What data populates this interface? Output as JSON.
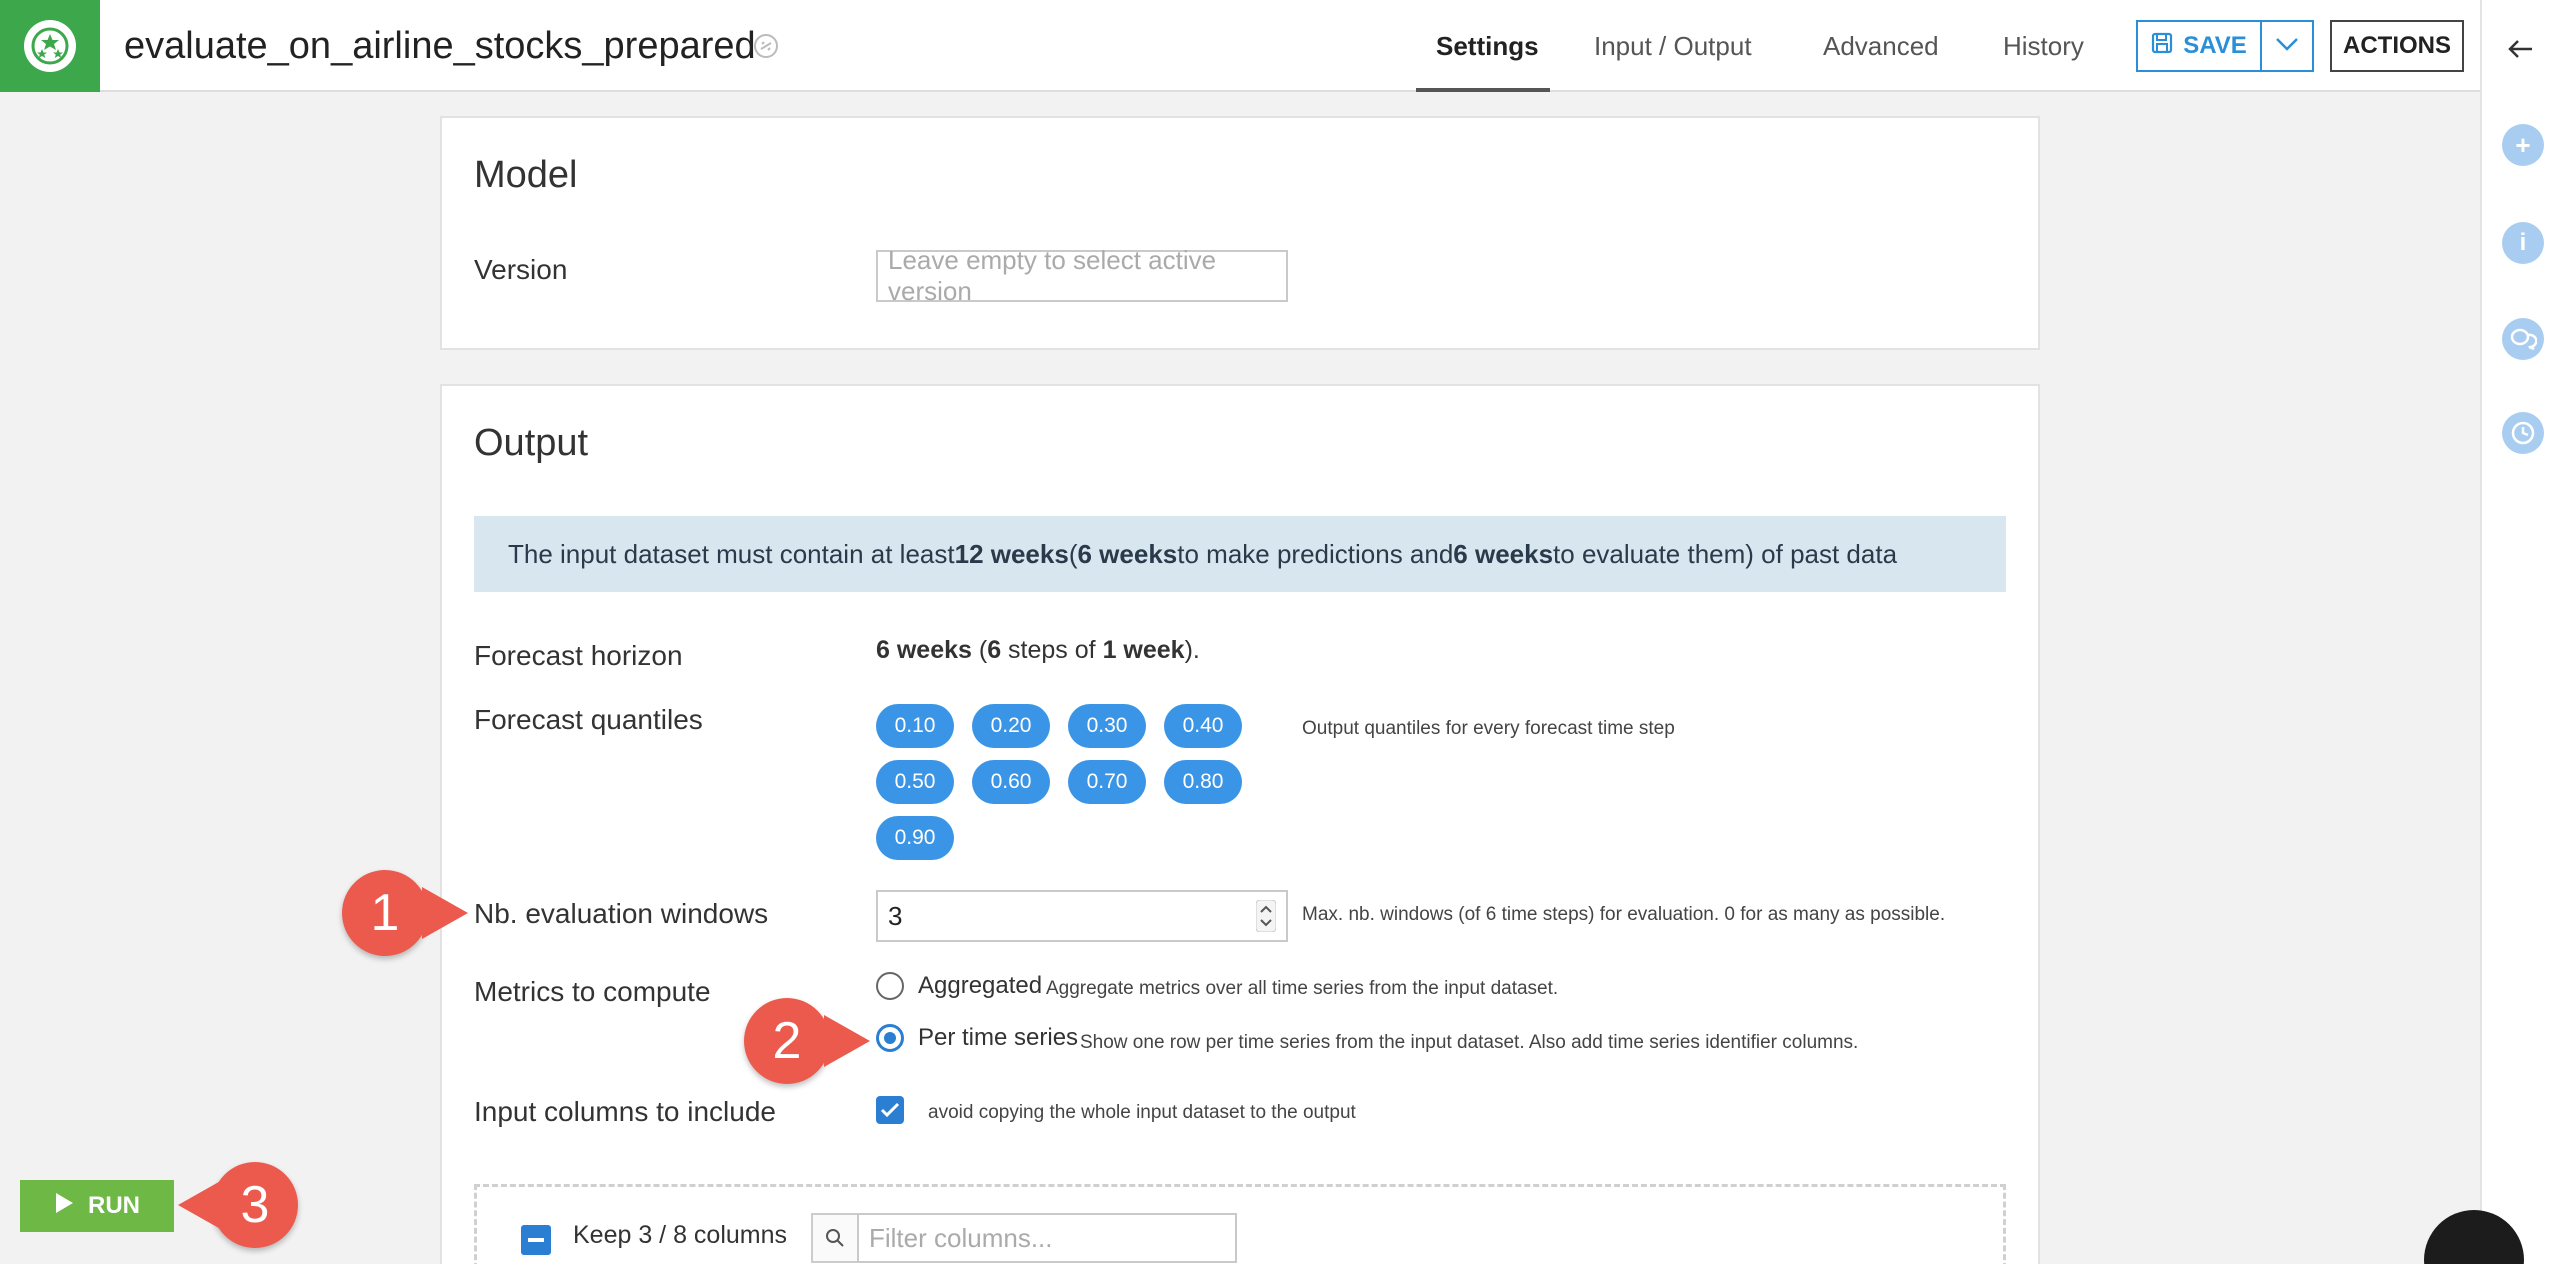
{
  "header": {
    "title": "evaluate_on_airline_stocks_prepared",
    "tabs": [
      "Settings",
      "Input / Output",
      "Advanced",
      "History"
    ],
    "save_label": "SAVE",
    "actions_label": "ACTIONS"
  },
  "model": {
    "title": "Model",
    "version_label": "Version",
    "version_placeholder": "Leave empty to select active version"
  },
  "output": {
    "title": "Output",
    "info": {
      "prefix": "The input dataset must contain at least ",
      "total": "12 weeks",
      "mid1": " (",
      "predict": "6 weeks",
      "mid2": " to make predictions and ",
      "evaluate": "6 weeks",
      "suffix": " to evaluate them) of past data"
    },
    "forecast_horizon_label": "Forecast horizon",
    "forecast_horizon": {
      "weeks": "6 weeks",
      "open": " (",
      "steps": "6",
      "mid": " steps of ",
      "step_size": "1 week",
      "close": ")."
    },
    "quantiles_label": "Forecast quantiles",
    "quantiles": [
      "0.10",
      "0.20",
      "0.30",
      "0.40",
      "0.50",
      "0.60",
      "0.70",
      "0.80",
      "0.90"
    ],
    "quantiles_hint": "Output quantiles for every forecast time step",
    "eval_windows_label": "Nb. evaluation windows",
    "eval_windows_value": "3",
    "eval_windows_hint": "Max. nb. windows (of 6 time steps) for evaluation. 0 for as many as possible.",
    "metrics_label": "Metrics to compute",
    "metrics_options": [
      {
        "label": "Aggregated",
        "hint": "Aggregate metrics over all time series from the input dataset."
      },
      {
        "label": "Per time series",
        "hint": "Show one row per time series from the input dataset. Also add time series identifier columns."
      }
    ],
    "input_columns_label": "Input columns to include",
    "input_columns_hint": "avoid copying the whole input dataset to the output",
    "keep_columns_label": "Keep 3 / 8 columns",
    "filter_placeholder": "Filter columns..."
  },
  "run_label": "RUN",
  "callouts": [
    "1",
    "2",
    "3"
  ],
  "colors": {
    "brand_green": "#3da84b",
    "accent_blue": "#2b8fd8",
    "chip_blue": "#3a95e6",
    "callout_red": "#ec5a4d",
    "run_green": "#6eb845"
  }
}
